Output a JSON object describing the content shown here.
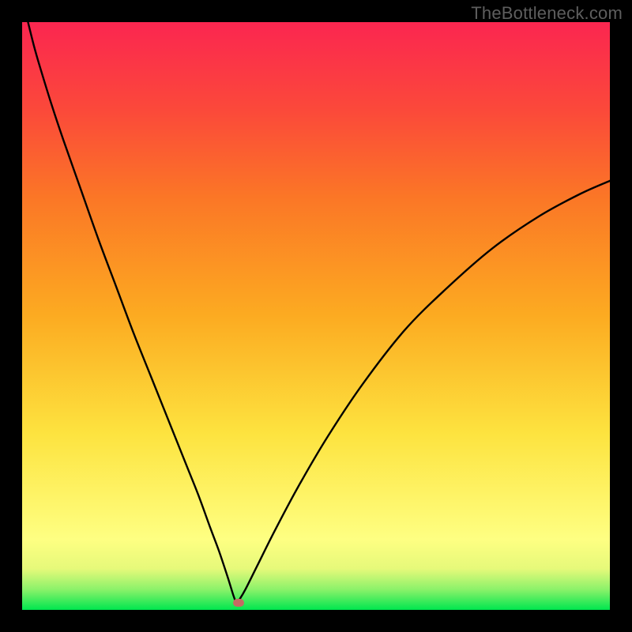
{
  "watermark": "TheBottleneck.com",
  "chart_data": {
    "type": "line",
    "title": "",
    "xlabel": "",
    "ylabel": "",
    "xlim": [
      0,
      100
    ],
    "ylim": [
      0,
      100
    ],
    "grid": false,
    "axes_visible": false,
    "background": {
      "type": "vertical-gradient",
      "description": "green (good / no bottleneck) at bottom through yellow and orange to red (severe bottleneck) at top",
      "stops": [
        {
          "pos": 0.0,
          "color": "#00e64f"
        },
        {
          "pos": 0.035,
          "color": "#8cf26a"
        },
        {
          "pos": 0.07,
          "color": "#e6f97a"
        },
        {
          "pos": 0.12,
          "color": "#feff82"
        },
        {
          "pos": 0.3,
          "color": "#fde33f"
        },
        {
          "pos": 0.5,
          "color": "#fcab21"
        },
        {
          "pos": 0.7,
          "color": "#fb7726"
        },
        {
          "pos": 0.85,
          "color": "#fb493a"
        },
        {
          "pos": 1.0,
          "color": "#fb2650"
        }
      ]
    },
    "series": [
      {
        "name": "bottleneck-curve",
        "description": "V-shaped bottleneck severity curve; minimum (best match) near x≈36",
        "x": [
          1,
          2,
          3,
          5,
          7,
          10,
          13,
          16,
          19,
          22,
          25,
          28,
          30,
          32,
          33.5,
          35,
          36,
          36.5,
          37,
          38,
          40,
          43,
          47,
          52,
          58,
          65,
          72,
          80,
          88,
          95,
          100
        ],
        "values": [
          100,
          96,
          92.5,
          86,
          80,
          71.5,
          63,
          55,
          47,
          39.5,
          32,
          24.5,
          19.5,
          14,
          10,
          5.5,
          2.3,
          1.2,
          1.8,
          3.5,
          7.5,
          13.5,
          21,
          29.5,
          38.5,
          47.5,
          54.5,
          61.5,
          67,
          70.8,
          73
        ]
      }
    ],
    "marker": {
      "description": "optimal / current configuration point",
      "x": 36.8,
      "y": 1.2,
      "color": "#c46a63"
    }
  }
}
